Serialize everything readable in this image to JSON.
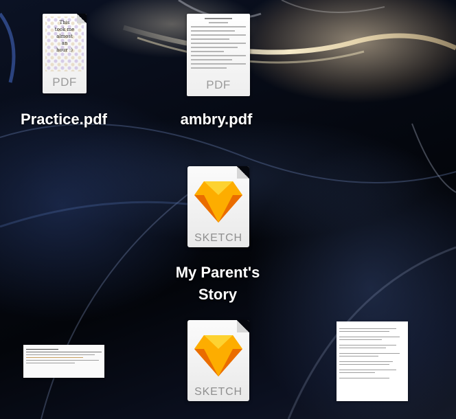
{
  "desktop": {
    "files": [
      {
        "id": "practice",
        "name": "Practice.pdf",
        "type_label": "PDF",
        "preview_text": [
          "This",
          "took me",
          "almost",
          "an",
          "hour :)"
        ]
      },
      {
        "id": "ambry",
        "name": "ambry.pdf",
        "type_label": "PDF"
      },
      {
        "id": "parents-story",
        "name_line1": "My Parent's",
        "name_line2": "Story",
        "type_label": "SKETCH"
      },
      {
        "id": "sketch-2",
        "type_label": "SKETCH"
      },
      {
        "id": "screenshot-left",
        "type_label": ""
      },
      {
        "id": "doc-right",
        "type_label": ""
      }
    ]
  }
}
